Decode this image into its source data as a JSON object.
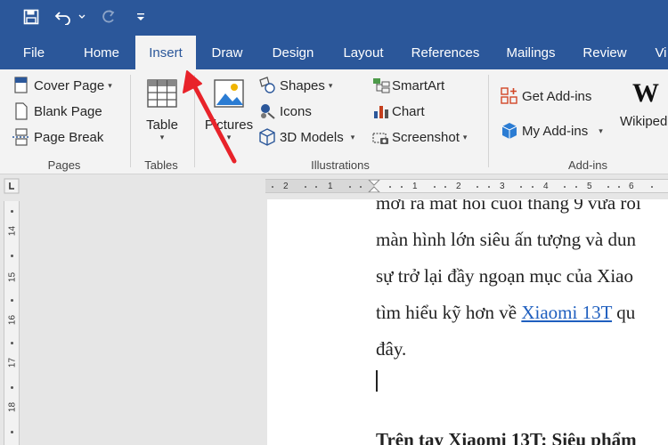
{
  "tabs": [
    "File",
    "Home",
    "Insert",
    "Draw",
    "Design",
    "Layout",
    "References",
    "Mailings",
    "Review",
    "Vi"
  ],
  "active_tab": "Insert",
  "ribbon": {
    "pages": {
      "cover_page": "Cover Page",
      "blank_page": "Blank Page",
      "page_break": "Page Break",
      "label": "Pages"
    },
    "tables": {
      "table": "Table",
      "label": "Tables"
    },
    "illustrations": {
      "pictures": "Pictures",
      "shapes": "Shapes",
      "icons": "Icons",
      "models_3d": "3D Models",
      "smartart": "SmartArt",
      "chart": "Chart",
      "screenshot": "Screenshot",
      "label": "Illustrations"
    },
    "addins": {
      "get_addins": "Get Add-ins",
      "my_addins": "My Add-ins",
      "wikipedia": "Wikiped",
      "label": "Add-ins"
    }
  },
  "ruler": {
    "h_ticks": [
      "2",
      "1",
      "1",
      "2",
      "3",
      "4",
      "5",
      "6"
    ],
    "v_ticks": [
      "14",
      "15",
      "16",
      "17",
      "18"
    ]
  },
  "document": {
    "line1": "mới ra mắt hồi cuối tháng 9 vừa rồi",
    "line2": "màn hình lớn siêu ấn tượng và dun",
    "line3": "sự trở lại đầy ngoạn mục của Xiao",
    "line4_before": "tìm hiểu kỹ hơn về ",
    "line4_link": "Xiaomi 13T",
    "line4_after": " qu",
    "line5": "đây.",
    "heading": "Trên tay Xiaomi 13T: Siêu phẩm"
  },
  "colors": {
    "accent": "#2b579a",
    "arrow": "#e8232a",
    "link": "#1f5fbf"
  }
}
